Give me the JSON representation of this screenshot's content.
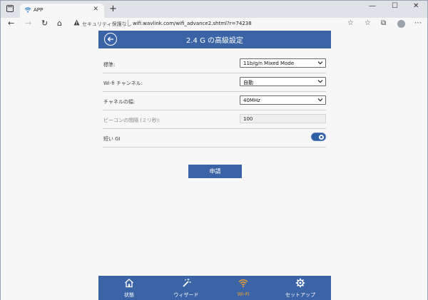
{
  "browser": {
    "tab_title": "APP",
    "tab_close": "✕",
    "new_tab": "+",
    "window_controls": [
      "—",
      "☐",
      "✕"
    ],
    "security_text": "セキュリティ保護なし",
    "url": "wifi.wavlink.com/wifi_advance2.shtml?r=74238",
    "icons": [
      "back-icon",
      "forward-icon",
      "refresh-icon",
      "home-icon",
      "warning-icon",
      "favorite-add-icon",
      "favorites-icon",
      "collections-icon",
      "more-icon",
      "profile-icon"
    ]
  },
  "header": {
    "title": "2.4 G の高級設定"
  },
  "form": {
    "rows": [
      {
        "label": "標準:",
        "value": "11b/g/n Mixed Mode"
      },
      {
        "label": "Wi-fi チャンネル:",
        "value": "自動"
      },
      {
        "label": "チャネルの幅:",
        "value": "40MHz"
      },
      {
        "label": "ビーコンの間隔 (ミリ秒):",
        "value": "100"
      },
      {
        "label": "短い GI",
        "value": "on"
      }
    ],
    "apply_label": "申請"
  },
  "bottom_nav": {
    "items": [
      {
        "label": "状態",
        "icon": "home-icon"
      },
      {
        "label": "ウィザード",
        "icon": "wizard-wand-icon"
      },
      {
        "label": "Wi-Fi",
        "icon": "wifi-icon",
        "active": true
      },
      {
        "label": "セットアップ",
        "icon": "gear-icon"
      }
    ],
    "active_color": "#f0a030"
  },
  "colors": {
    "accent": "#3b64a7"
  }
}
